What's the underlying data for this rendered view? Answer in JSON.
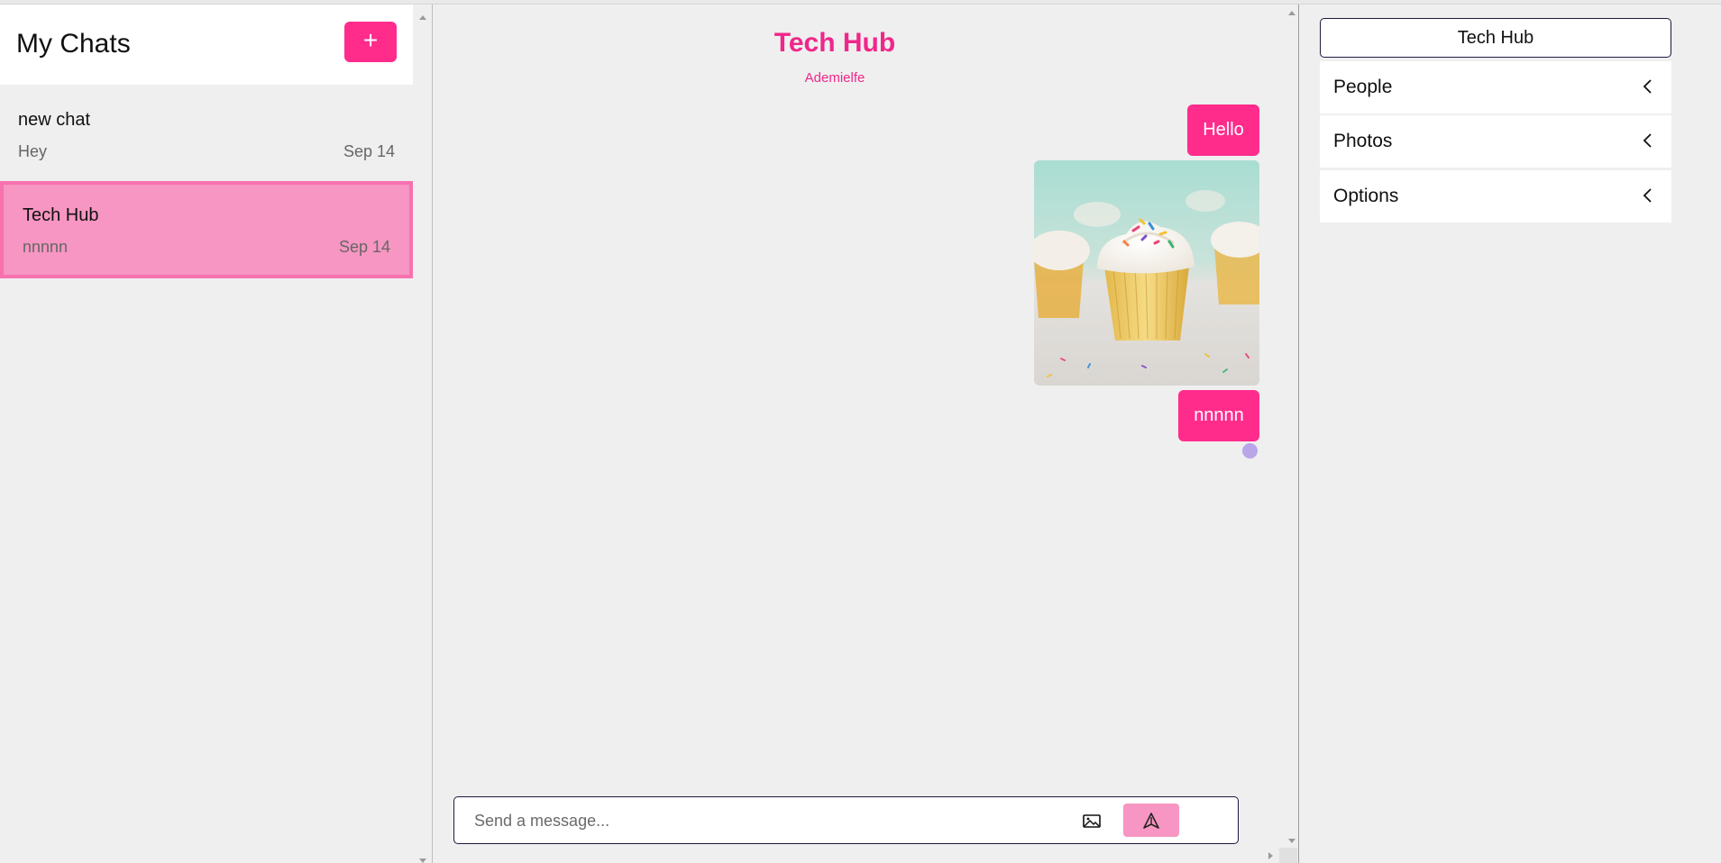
{
  "sidebar": {
    "title": "My Chats",
    "new_chat_label": "+",
    "chats": [
      {
        "name": "new chat",
        "preview": "Hey",
        "date": "Sep 14"
      },
      {
        "name": "Tech Hub",
        "preview": "nnnnn",
        "date": "Sep 14",
        "selected": true
      }
    ]
  },
  "main": {
    "title": "Tech Hub",
    "subtitle": "Ademielfe",
    "messages": [
      {
        "type": "text",
        "text": "Hello"
      },
      {
        "type": "image",
        "alt": "cupcake-photo"
      },
      {
        "type": "text",
        "text": "nnnnn"
      }
    ],
    "composer": {
      "placeholder": "Send a message...",
      "value": ""
    }
  },
  "right_panel": {
    "title": "Tech Hub",
    "sections": [
      {
        "label": "People"
      },
      {
        "label": "Photos"
      },
      {
        "label": "Options"
      }
    ]
  },
  "colors": {
    "accent": "#ff2c8c",
    "accent_light": "#f796c2",
    "title_pink": "#ef278a",
    "seen_dot": "#b9a6e8",
    "border_dark": "#1a1a40"
  },
  "icons": [
    "plus-icon",
    "image-icon",
    "send-icon",
    "chevron-left-icon"
  ]
}
